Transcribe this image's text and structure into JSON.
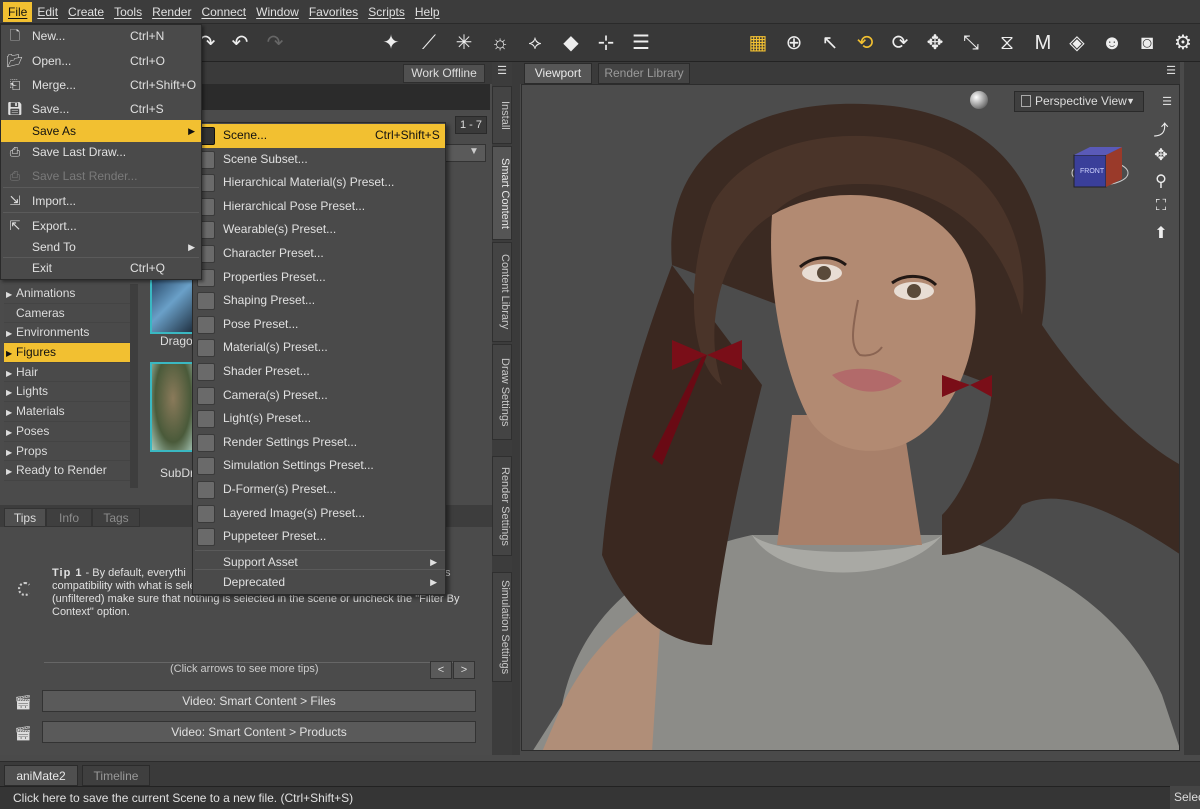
{
  "menubar": [
    "File",
    "Edit",
    "Create",
    "Tools",
    "Render",
    "Connect",
    "Window",
    "Favorites",
    "Scripts",
    "Help"
  ],
  "file_menu": [
    {
      "label": "New...",
      "shortcut": "Ctrl+N",
      "icon": "new-file-icon"
    },
    {
      "label": "Open...",
      "shortcut": "Ctrl+O",
      "icon": "open-folder-icon"
    },
    {
      "label": "Merge...",
      "shortcut": "Ctrl+Shift+O",
      "icon": "merge-icon"
    },
    {
      "label": "Save...",
      "shortcut": "Ctrl+S",
      "icon": "save-disk-icon"
    },
    {
      "label": "Save As",
      "shortcut": "",
      "icon": "",
      "submenu": true
    },
    {
      "label": "Save Last Draw...",
      "shortcut": "",
      "icon": "save-draw-icon"
    },
    {
      "label": "Save Last Render...",
      "shortcut": "",
      "icon": "save-render-icon",
      "disabled": true
    },
    {
      "label": "Import...",
      "shortcut": "",
      "icon": "import-icon"
    },
    {
      "label": "Export...",
      "shortcut": "",
      "icon": "export-icon"
    },
    {
      "label": "Send To",
      "shortcut": "",
      "icon": "",
      "submenu": true
    },
    {
      "label": "Exit",
      "shortcut": "Ctrl+Q",
      "icon": ""
    }
  ],
  "save_as_menu": [
    {
      "label": "Scene...",
      "shortcut": "Ctrl+Shift+S"
    },
    {
      "label": "Scene Subset..."
    },
    {
      "label": "Hierarchical Material(s) Preset..."
    },
    {
      "label": "Hierarchical Pose Preset..."
    },
    {
      "label": "Wearable(s) Preset..."
    },
    {
      "label": "Character Preset..."
    },
    {
      "label": "Properties Preset..."
    },
    {
      "label": "Shaping Preset..."
    },
    {
      "label": "Pose Preset..."
    },
    {
      "label": "Material(s) Preset..."
    },
    {
      "label": "Shader Preset..."
    },
    {
      "label": "Camera(s) Preset..."
    },
    {
      "label": "Light(s) Preset..."
    },
    {
      "label": "Render Settings Preset..."
    },
    {
      "label": "Simulation Settings Preset..."
    },
    {
      "label": "D-Former(s) Preset..."
    },
    {
      "label": "Layered Image(s) Preset..."
    },
    {
      "label": "Puppeteer Preset..."
    },
    {
      "label": "Support Asset",
      "submenu": true
    },
    {
      "label": "Deprecated",
      "submenu": true
    }
  ],
  "content": {
    "work_offline": "Work Offline",
    "pager": "1 - 7",
    "categories": [
      "Animations",
      "Cameras",
      "Environments",
      "Figures",
      "Hair",
      "Lights",
      "Materials",
      "Poses",
      "Props",
      "Ready to Render"
    ],
    "selected_category": "Figures",
    "thumb_labels": [
      "Drago",
      "SubDr"
    ]
  },
  "tips": {
    "tabs": [
      "Tips",
      "Info",
      "Tags"
    ],
    "title": "Tip 1",
    "text": " - By default, everythi... compatibility with what is selec... (unfiltered) make sure that nothing is selected in the scene or uncheck the \"Filter By Context\" option.",
    "line1": " - By default, everythi",
    "line1_tail": "s",
    "line2": "compatibility with what is selec",
    "line3": "(unfiltered) make sure that nothing is selected in the scene or uncheck the \"Filter By",
    "line4": "Context\" option.",
    "nav": "(Click arrows to see more tips)",
    "video1": "Video: Smart Content > Files",
    "video2": "Video: Smart Content > Products"
  },
  "side_tabs": [
    "Install",
    "Smart Content",
    "Content Library",
    "Draw Settings",
    "Render Settings",
    "Simulation Settings"
  ],
  "viewport": {
    "tabs": [
      "Viewport",
      "Render Library"
    ],
    "view": "Perspective View",
    "cube_label": "FRONT"
  },
  "bottom_tabs": [
    "aniMate2",
    "Timeline"
  ],
  "status": "Click here to save the current Scene to a new file. (Ctrl+Shift+S)",
  "status_right": "Selec",
  "colors": {
    "accent": "#f2c031",
    "panel": "#4a4a4a",
    "thumb_border": "#3ab8c2"
  }
}
